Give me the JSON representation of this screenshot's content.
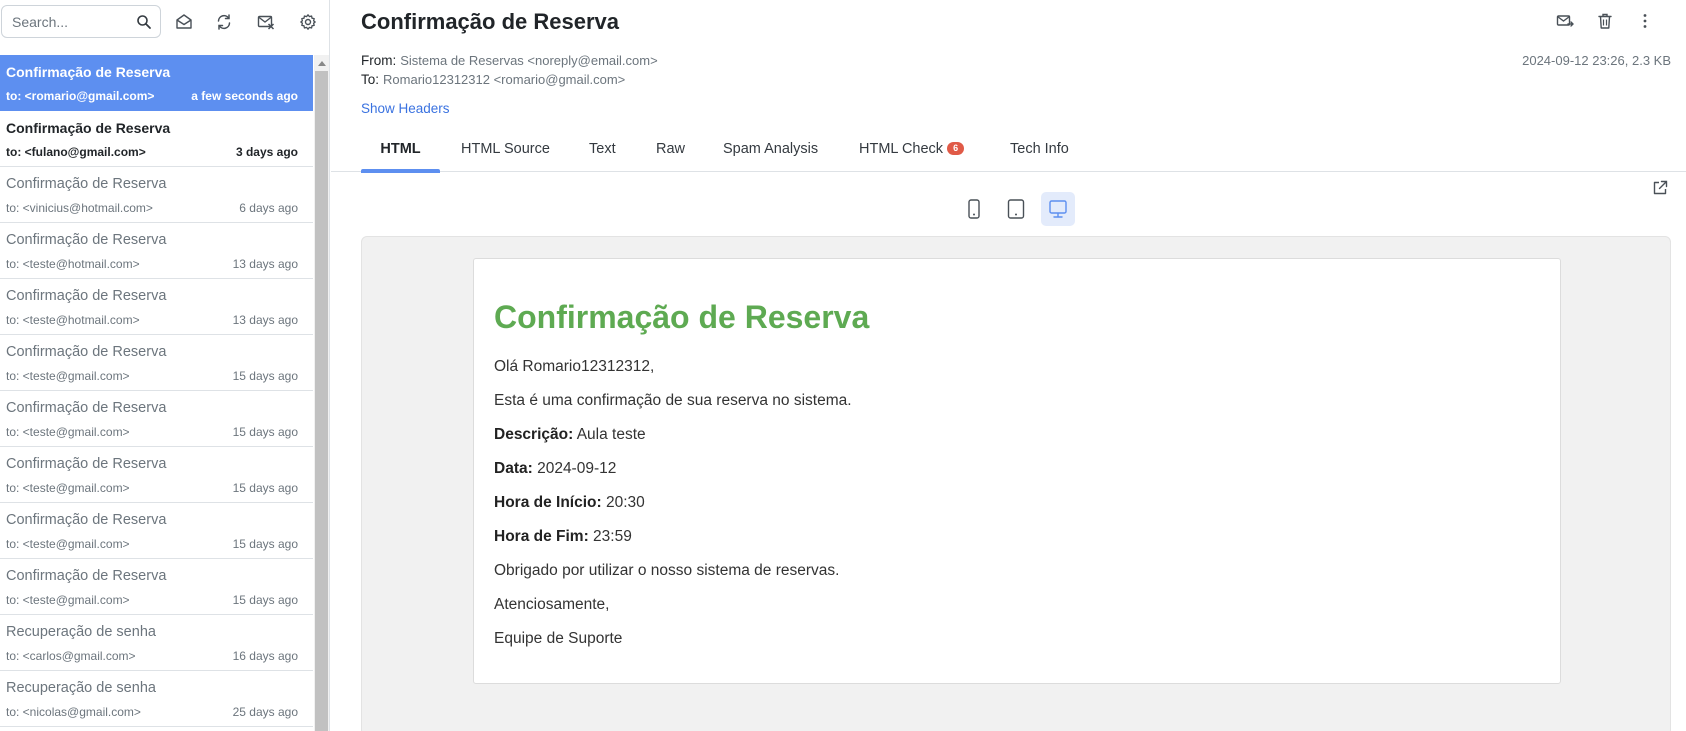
{
  "sidebar": {
    "search_placeholder": "Search...",
    "messages": [
      {
        "subject": "Confirmação de Reserva",
        "to": "to: <romario@gmail.com>",
        "when": "a few seconds ago"
      },
      {
        "subject": "Confirmação de Reserva",
        "to": "to: <fulano@gmail.com>",
        "when": "3 days ago"
      },
      {
        "subject": "Confirmação de Reserva",
        "to": "to: <vinicius@hotmail.com>",
        "when": "6 days ago"
      },
      {
        "subject": "Confirmação de Reserva",
        "to": "to: <teste@hotmail.com>",
        "when": "13 days ago"
      },
      {
        "subject": "Confirmação de Reserva",
        "to": "to: <teste@hotmail.com>",
        "when": "13 days ago"
      },
      {
        "subject": "Confirmação de Reserva",
        "to": "to: <teste@gmail.com>",
        "when": "15 days ago"
      },
      {
        "subject": "Confirmação de Reserva",
        "to": "to: <teste@gmail.com>",
        "when": "15 days ago"
      },
      {
        "subject": "Confirmação de Reserva",
        "to": "to: <teste@gmail.com>",
        "when": "15 days ago"
      },
      {
        "subject": "Confirmação de Reserva",
        "to": "to: <teste@gmail.com>",
        "when": "15 days ago"
      },
      {
        "subject": "Confirmação de Reserva",
        "to": "to: <teste@gmail.com>",
        "when": "15 days ago"
      },
      {
        "subject": "Recuperação de senha",
        "to": "to: <carlos@gmail.com>",
        "when": "16 days ago"
      },
      {
        "subject": "Recuperação de senha",
        "to": "to: <nicolas@gmail.com>",
        "when": "25 days ago"
      }
    ]
  },
  "message": {
    "subject": "Confirmação de Reserva",
    "from_label": "From:",
    "from": "Sistema de Reservas <noreply@email.com>",
    "to_label": "To:",
    "to": "Romario12312312 <romario@gmail.com>",
    "meta": "2024-09-12 23:26, 2.3 KB",
    "show_headers": "Show Headers"
  },
  "tabs": {
    "html": "HTML",
    "html_source": "HTML Source",
    "text": "Text",
    "raw": "Raw",
    "spam": "Spam Analysis",
    "html_check": "HTML Check",
    "html_check_badge": "6",
    "tech_info": "Tech Info"
  },
  "email": {
    "heading": "Confirmação de Reserva",
    "greeting": "Olá Romario12312312,",
    "intro": "Esta é uma confirmação de sua reserva no sistema.",
    "desc_label": "Descrição:",
    "desc_value": "Aula teste",
    "date_label": "Data:",
    "date_value": "2024-09-12",
    "start_label": "Hora de Início:",
    "start_value": "20:30",
    "end_label": "Hora de Fim:",
    "end_value": "23:59",
    "thanks": "Obrigado por utilizar o nosso sistema de reservas.",
    "regards": "Atenciosamente,",
    "signature": "Equipe de Suporte"
  },
  "colors": {
    "accent": "#5d8ff0",
    "heading_green": "#5eaa52",
    "badge_red": "#e05a47"
  }
}
